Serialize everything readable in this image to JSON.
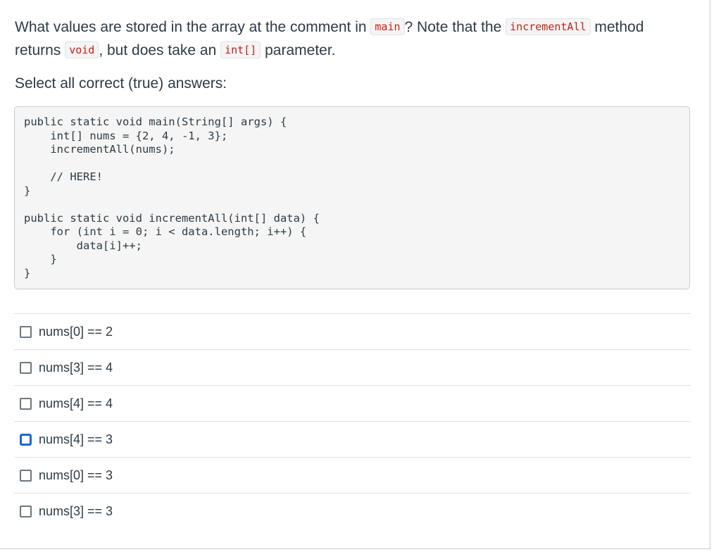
{
  "question": {
    "text_1": "What values are stored in the array at the comment in ",
    "code_1": "main",
    "text_2": "? Note that the ",
    "code_2": "incrementAll",
    "text_3": " method returns ",
    "code_3": "void",
    "text_4": ", but does take an ",
    "code_4": "int[]",
    "text_5": " parameter."
  },
  "instruction": "Select all correct (true) answers:",
  "code_block": "public static void main(String[] args) {\n    int[] nums = {2, 4, -1, 3};\n    incrementAll(nums);\n\n    // HERE!\n}\n\npublic static void incrementAll(int[] data) {\n    for (int i = 0; i < data.length; i++) {\n        data[i]++;\n    }\n}",
  "answers": [
    {
      "label": "nums[0] == 2",
      "checked": false,
      "focused": false
    },
    {
      "label": "nums[3] == 4",
      "checked": false,
      "focused": false
    },
    {
      "label": "nums[4] == 4",
      "checked": false,
      "focused": false
    },
    {
      "label": "nums[4] == 3",
      "checked": false,
      "focused": true
    },
    {
      "label": "nums[0] == 3",
      "checked": false,
      "focused": false
    },
    {
      "label": "nums[3] == 3",
      "checked": false,
      "focused": false
    }
  ],
  "colors": {
    "text": "#2d3b45",
    "inline_code": "#d01a19",
    "code_background": "#f5f5f5",
    "border": "#c7cdd1",
    "focus_accent": "#1967d2"
  }
}
